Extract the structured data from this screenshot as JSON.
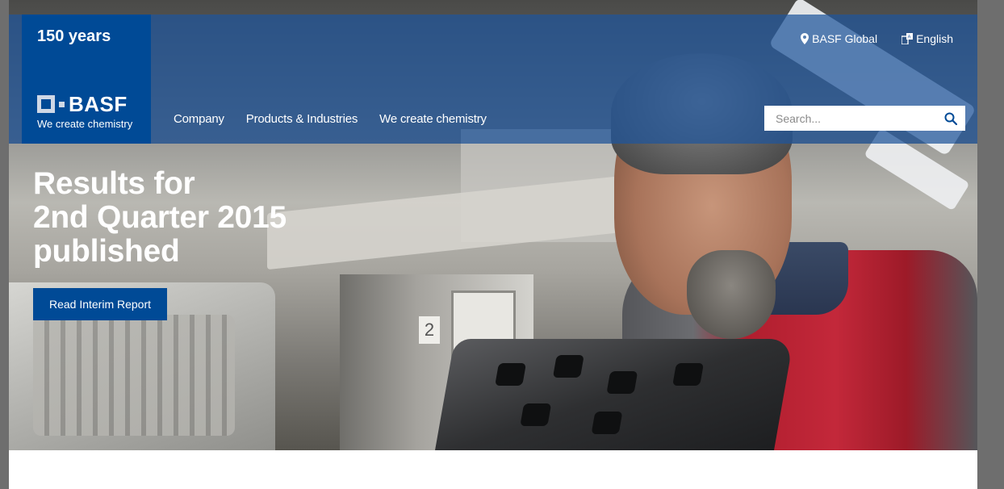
{
  "brand": {
    "anniversary": "150 years",
    "name": "BASF",
    "tagline": "We create chemistry"
  },
  "nav": {
    "items": [
      {
        "label": "Company"
      },
      {
        "label": "Products & Industries"
      },
      {
        "label": "We create chemistry"
      }
    ]
  },
  "utility": {
    "region_label": "BASF Global",
    "region_icon": "location-pin-icon",
    "language_label": "English",
    "language_icon": "language-icon"
  },
  "search": {
    "placeholder": "Search...",
    "value": "",
    "icon": "search-icon"
  },
  "hero": {
    "headline_lines": [
      "Results for",
      "2nd Quarter 2015",
      "published"
    ],
    "cta_label": "Read Interim Report",
    "machine_label": "2"
  },
  "colors": {
    "brand_blue": "#004a96",
    "header_overlay": "#1e549b",
    "text_on_blue": "#ffffff"
  }
}
